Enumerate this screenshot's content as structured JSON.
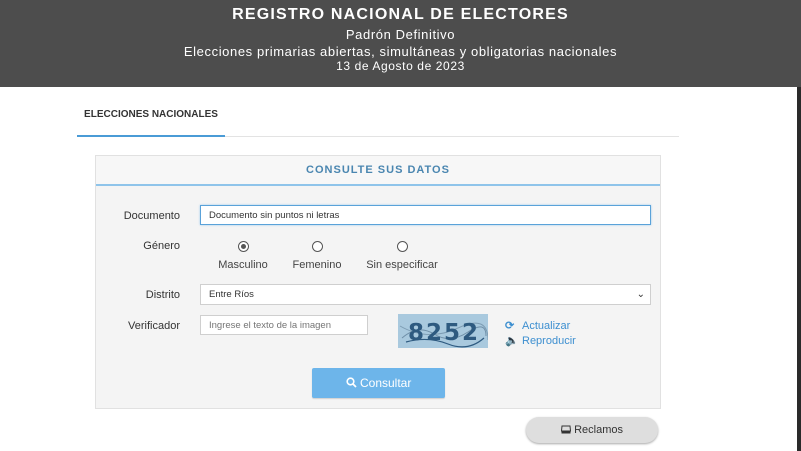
{
  "header": {
    "title": "REGISTRO NACIONAL DE ELECTORES",
    "subtitle": "Padrón Definitivo",
    "election": "Elecciones primarias abiertas, simultáneas y obligatorias nacionales",
    "date": "13 de Agosto de 2023"
  },
  "tabs": [
    {
      "label": "ELECCIONES NACIONALES",
      "active": true
    }
  ],
  "form": {
    "title": "CONSULTE SUS DATOS",
    "documento": {
      "label": "Documento",
      "value": "Documento sin puntos ni letras"
    },
    "genero": {
      "label": "Género",
      "options": [
        {
          "label": "Masculino",
          "checked": true
        },
        {
          "label": "Femenino",
          "checked": false
        },
        {
          "label": "Sin especificar",
          "checked": false
        }
      ]
    },
    "distrito": {
      "label": "Distrito",
      "value": "Entre Ríos"
    },
    "verificador": {
      "label": "Verificador",
      "placeholder": "Ingrese el texto de la imagen",
      "captcha_text": "8252"
    },
    "actualizar": {
      "label": "Actualizar",
      "icon": "refresh-icon"
    },
    "reproducir": {
      "label": "Reproducir",
      "icon": "speaker-icon"
    },
    "submit": {
      "label": "Consultar",
      "icon": "search-icon"
    }
  },
  "reclamos": {
    "label": "Reclamos",
    "icon": "inbox-icon"
  },
  "colors": {
    "header_bg": "#4d4d4d",
    "accent": "#4a9bd6",
    "button": "#6db5ea",
    "panel_title": "#4a86b0"
  }
}
